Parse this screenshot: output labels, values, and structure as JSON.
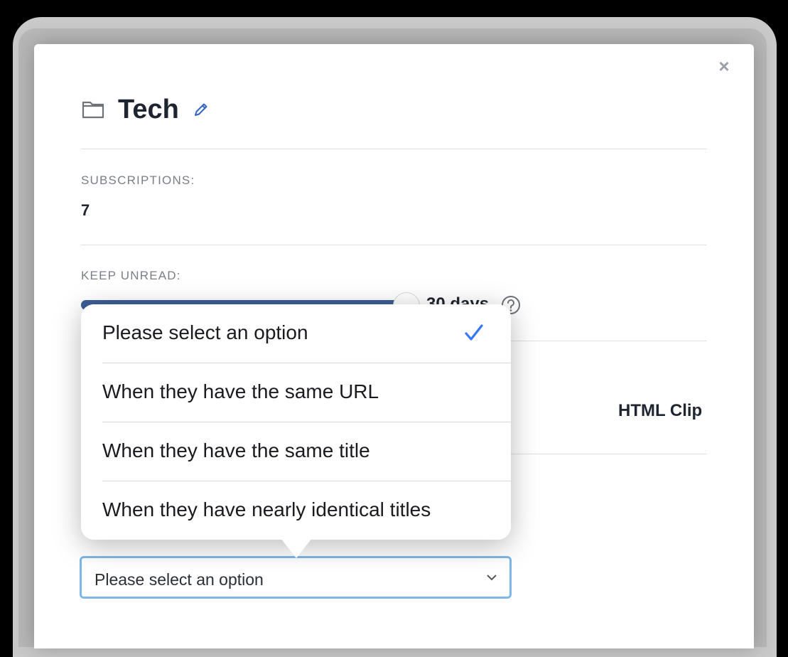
{
  "modal": {
    "title": "Tech",
    "close_label": "×",
    "subscriptions_label": "SUBSCRIPTIONS:",
    "subscriptions_value": "7",
    "keep_unread_label": "KEEP UNREAD:",
    "keep_unread_value": "30 days",
    "keep_unread_fraction": 0.52,
    "side_text": "HTML Clip"
  },
  "select": {
    "value": "Please select an option"
  },
  "popover": {
    "options": [
      {
        "label": "Please select an option",
        "selected": true
      },
      {
        "label": "When they have the same URL",
        "selected": false
      },
      {
        "label": "When they have the same title",
        "selected": false
      },
      {
        "label": "When they have nearly identical titles",
        "selected": false
      }
    ]
  },
  "colors": {
    "accent": "#3478f6",
    "slider": "#3d5f94",
    "select_border": "#7fb6e6"
  },
  "icons": {
    "folder": "folder-icon",
    "edit": "pencil-icon",
    "close": "close-icon",
    "help": "question-circle-icon",
    "check": "checkmark-icon",
    "chevron": "chevron-down-icon"
  }
}
